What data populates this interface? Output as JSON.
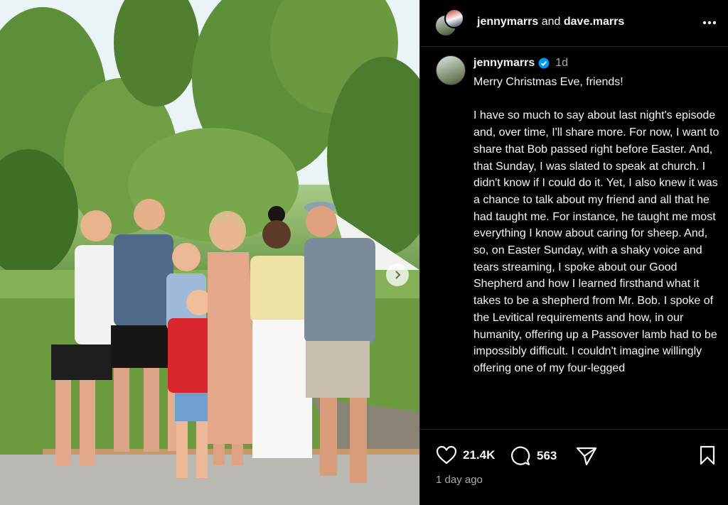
{
  "header": {
    "user1": "jennymarrs",
    "joiner": "and",
    "user2": "dave.marrs",
    "more_icon": "more-horizontal-icon"
  },
  "caption": {
    "username": "jennymarrs",
    "time": "1d",
    "paragraphs": [
      "Merry Christmas Eve, friends!",
      "I have so much to say about last night's episode and, over time, I'll share more. For now, I want to share that Bob passed right before Easter. And, that Sunday, I was slated to speak at church. I didn't know if I could do it. Yet, I also knew it was a chance to talk about my friend and all that he had taught me. For instance, he taught me most everything I know about caring for sheep. And, so, on Easter Sunday, with a shaky voice and tears streaming, I spoke about our Good Shepherd and how I learned firsthand what it takes to be a shepherd from Mr. Bob. I spoke of the Levitical requirements and how, in our humanity, offering up a Passover lamb had to be impossibly difficult. I couldn't imagine willingly offering one of my four-legged"
    ]
  },
  "actions": {
    "likes": "21.4K",
    "comments": "563",
    "posted": "1 day ago"
  },
  "colors": {
    "background": "#000000",
    "text": "#f5f5f5",
    "muted": "#a8a8a8",
    "verified": "#0095f6"
  }
}
